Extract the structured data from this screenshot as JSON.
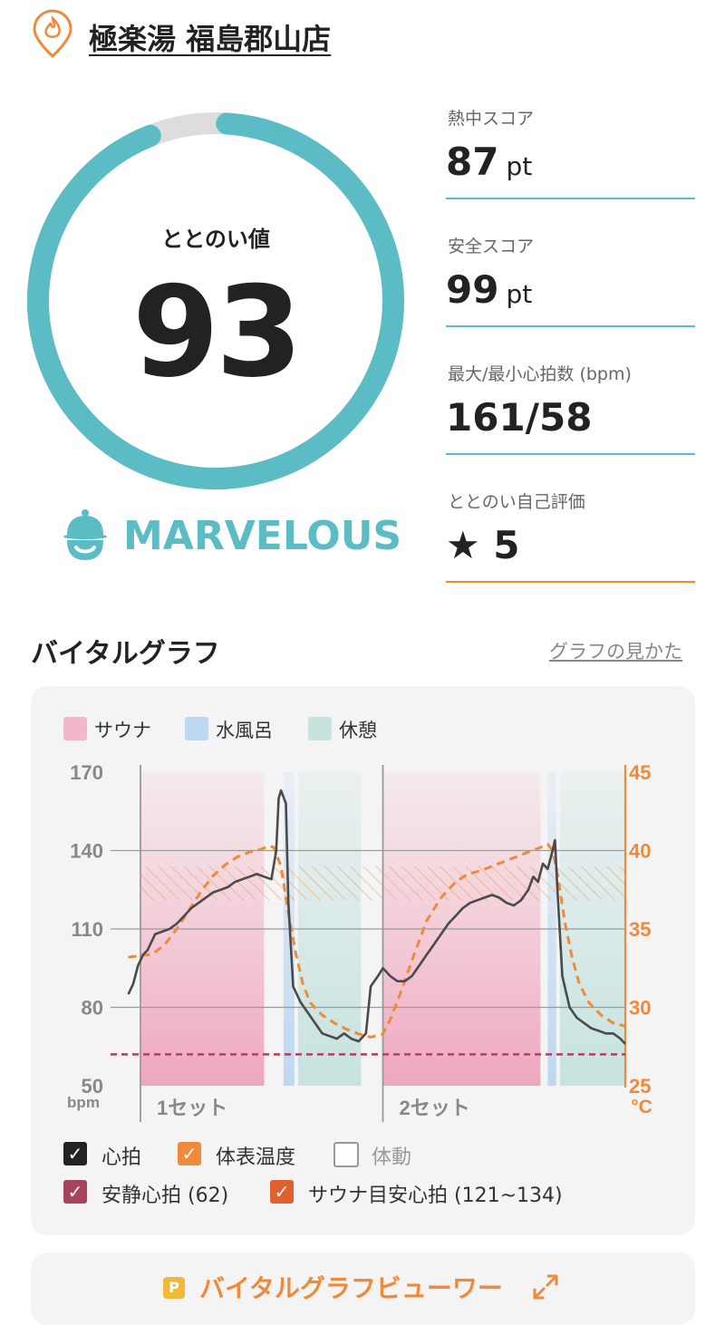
{
  "header": {
    "venue_name": "極楽湯 福島郡山店",
    "venue_icon": "flame-pin-icon"
  },
  "totonoi": {
    "label": "ととのい値",
    "value": "93",
    "score_fraction": 0.93,
    "rank": "MARVELOUS",
    "rank_icon": "sauna-hat-face-icon"
  },
  "scores": [
    {
      "label": "熱中スコア",
      "value": "87",
      "unit": "pt"
    },
    {
      "label": "安全スコア",
      "value": "99",
      "unit": "pt"
    },
    {
      "label": "最大/最小心拍数 (bpm)",
      "value": "161/58",
      "unit": ""
    },
    {
      "label": "ととのい自己評価",
      "value": "★ 5",
      "unit": ""
    }
  ],
  "section": {
    "title": "バイタルグラフ",
    "help_link": "グラフの見かた"
  },
  "colors": {
    "accent_teal": "#5bbcc5",
    "orange": "#ef8a3a",
    "sauna": "#f2b8c9",
    "cold_bath": "#bcd8f2",
    "rest": "#c6e3e0",
    "heart": "#4a4a4a",
    "resting": "#a8435e",
    "sauna_target": "#e06030"
  },
  "chart_data": {
    "type": "line",
    "legend": [
      {
        "name": "サウナ",
        "color": "#f2b8c9"
      },
      {
        "name": "水風呂",
        "color": "#bcd8f2"
      },
      {
        "name": "休憩",
        "color": "#c6e3e0"
      }
    ],
    "y_left": {
      "unit": "bpm",
      "ticks": [
        "170",
        "140",
        "110",
        "80",
        "50"
      ],
      "range": [
        50,
        170
      ]
    },
    "y_right": {
      "unit": "°C",
      "ticks": [
        "45",
        "40",
        "35",
        "30",
        "25"
      ],
      "range": [
        25,
        45
      ]
    },
    "x_range": [
      0,
      2
    ],
    "sets": [
      {
        "label": "1セット",
        "start": 0.0
      },
      {
        "label": "2セット",
        "start": 1.0
      }
    ],
    "phases": [
      {
        "type": "sauna",
        "from": 0.0,
        "to": 0.51
      },
      {
        "type": "cold",
        "from": 0.59,
        "to": 0.635
      },
      {
        "type": "rest",
        "from": 0.65,
        "to": 0.91
      },
      {
        "type": "sauna",
        "from": 1.0,
        "to": 1.65
      },
      {
        "type": "cold",
        "from": 1.68,
        "to": 1.715
      },
      {
        "type": "rest",
        "from": 1.73,
        "to": 2.0
      }
    ],
    "resting_hr": 62,
    "sauna_target_range": [
      121,
      134
    ],
    "series": [
      {
        "name": "心拍",
        "axis": "left",
        "points": [
          [
            -0.05,
            85
          ],
          [
            -0.03,
            89
          ],
          [
            -0.01,
            96
          ],
          [
            0.01,
            100
          ],
          [
            0.03,
            102
          ],
          [
            0.06,
            108
          ],
          [
            0.09,
            109
          ],
          [
            0.12,
            110
          ],
          [
            0.15,
            112
          ],
          [
            0.18,
            115
          ],
          [
            0.21,
            118
          ],
          [
            0.24,
            120
          ],
          [
            0.27,
            122
          ],
          [
            0.3,
            124
          ],
          [
            0.33,
            125
          ],
          [
            0.36,
            126
          ],
          [
            0.39,
            128
          ],
          [
            0.42,
            129
          ],
          [
            0.45,
            130
          ],
          [
            0.48,
            131
          ],
          [
            0.51,
            130
          ],
          [
            0.54,
            129
          ],
          [
            0.56,
            140
          ],
          [
            0.57,
            160
          ],
          [
            0.58,
            163
          ],
          [
            0.6,
            158
          ],
          [
            0.61,
            120
          ],
          [
            0.63,
            88
          ],
          [
            0.66,
            82
          ],
          [
            0.69,
            78
          ],
          [
            0.72,
            74
          ],
          [
            0.75,
            70
          ],
          [
            0.78,
            69
          ],
          [
            0.81,
            68
          ],
          [
            0.84,
            70
          ],
          [
            0.87,
            68
          ],
          [
            0.9,
            67
          ],
          [
            0.93,
            70
          ],
          [
            0.95,
            88
          ],
          [
            0.98,
            92
          ],
          [
            1.0,
            95
          ],
          [
            1.03,
            92
          ],
          [
            1.06,
            90
          ],
          [
            1.09,
            90
          ],
          [
            1.12,
            92
          ],
          [
            1.15,
            96
          ],
          [
            1.18,
            100
          ],
          [
            1.21,
            104
          ],
          [
            1.24,
            108
          ],
          [
            1.27,
            112
          ],
          [
            1.3,
            115
          ],
          [
            1.33,
            118
          ],
          [
            1.36,
            120
          ],
          [
            1.39,
            121
          ],
          [
            1.42,
            122
          ],
          [
            1.45,
            123
          ],
          [
            1.48,
            122
          ],
          [
            1.51,
            120
          ],
          [
            1.54,
            119
          ],
          [
            1.57,
            121
          ],
          [
            1.6,
            125
          ],
          [
            1.62,
            130
          ],
          [
            1.64,
            128
          ],
          [
            1.66,
            135
          ],
          [
            1.68,
            133
          ],
          [
            1.7,
            140
          ],
          [
            1.71,
            144
          ],
          [
            1.72,
            125
          ],
          [
            1.74,
            92
          ],
          [
            1.77,
            80
          ],
          [
            1.8,
            76
          ],
          [
            1.83,
            74
          ],
          [
            1.86,
            72
          ],
          [
            1.89,
            71
          ],
          [
            1.92,
            70
          ],
          [
            1.95,
            70
          ],
          [
            1.98,
            68
          ],
          [
            2.0,
            66
          ]
        ]
      },
      {
        "name": "体表温度",
        "axis": "right",
        "points": [
          [
            -0.05,
            33.2
          ],
          [
            0.0,
            33.3
          ],
          [
            0.05,
            33.4
          ],
          [
            0.1,
            34.0
          ],
          [
            0.15,
            35.0
          ],
          [
            0.2,
            36.2
          ],
          [
            0.25,
            37.4
          ],
          [
            0.3,
            38.4
          ],
          [
            0.35,
            39.1
          ],
          [
            0.4,
            39.6
          ],
          [
            0.45,
            39.9
          ],
          [
            0.5,
            40.1
          ],
          [
            0.53,
            40.3
          ],
          [
            0.55,
            40.2
          ],
          [
            0.58,
            39.0
          ],
          [
            0.61,
            36.0
          ],
          [
            0.64,
            33.5
          ],
          [
            0.67,
            31.5
          ],
          [
            0.7,
            30.3
          ],
          [
            0.75,
            29.5
          ],
          [
            0.8,
            29.0
          ],
          [
            0.85,
            28.6
          ],
          [
            0.9,
            28.3
          ],
          [
            0.95,
            28.1
          ],
          [
            1.0,
            28.3
          ],
          [
            1.03,
            29.2
          ],
          [
            1.07,
            30.8
          ],
          [
            1.12,
            33.0
          ],
          [
            1.18,
            35.5
          ],
          [
            1.24,
            37.0
          ],
          [
            1.3,
            38.0
          ],
          [
            1.35,
            38.5
          ],
          [
            1.4,
            38.7
          ],
          [
            1.45,
            39.0
          ],
          [
            1.5,
            39.3
          ],
          [
            1.55,
            39.6
          ],
          [
            1.6,
            39.9
          ],
          [
            1.65,
            40.2
          ],
          [
            1.68,
            40.4
          ],
          [
            1.7,
            40.0
          ],
          [
            1.72,
            38.5
          ],
          [
            1.75,
            35.5
          ],
          [
            1.78,
            33.2
          ],
          [
            1.81,
            31.5
          ],
          [
            1.85,
            30.3
          ],
          [
            1.9,
            29.5
          ],
          [
            1.95,
            29.0
          ],
          [
            2.0,
            28.8
          ]
        ]
      }
    ]
  },
  "checkboxes": [
    {
      "label": "心拍",
      "checked": true,
      "color": "#222222"
    },
    {
      "label": "体表温度",
      "checked": true,
      "color": "#ef8a3a"
    },
    {
      "label": "体動",
      "checked": false,
      "color": "#999999"
    },
    {
      "label": "安静心拍 (62)",
      "checked": true,
      "color": "#a8435e"
    },
    {
      "label": "サウナ目安心拍 (121~134)",
      "checked": true,
      "color": "#e06030"
    }
  ],
  "viewer": {
    "badge": "P",
    "label": "バイタルグラフビューワー",
    "icon": "expand-arrows-icon"
  }
}
